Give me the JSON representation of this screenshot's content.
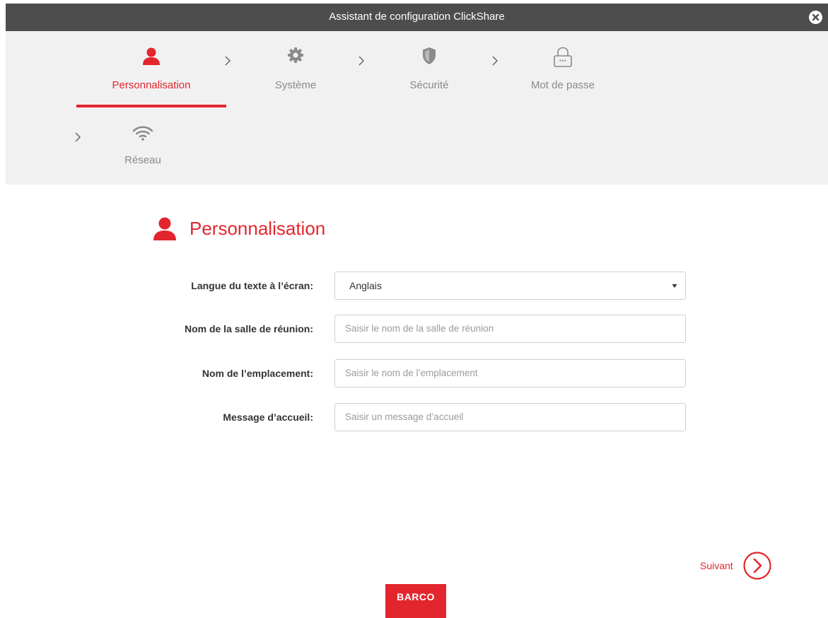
{
  "window": {
    "title": "Assistant de configuration ClickShare"
  },
  "steps": [
    {
      "label": "Personnalisation",
      "icon": "user-icon",
      "active": true
    },
    {
      "label": "Système",
      "icon": "gear-icon",
      "active": false
    },
    {
      "label": "Sécurité",
      "icon": "shield-icon",
      "active": false
    },
    {
      "label": "Mot de passe",
      "icon": "lock-icon",
      "active": false
    },
    {
      "label": "Réseau",
      "icon": "wifi-icon",
      "active": false
    }
  ],
  "section": {
    "title": "Personnalisation",
    "icon": "user-icon"
  },
  "form": {
    "language": {
      "label": "Langue du texte à l’écran:",
      "value": "Anglais"
    },
    "room_name": {
      "label": "Nom de la salle de réunion:",
      "placeholder": "Saisir le nom de la salle de réunion",
      "value": ""
    },
    "location": {
      "label": "Nom de l’emplacement:",
      "placeholder": "Saisir le nom de l’emplacement",
      "value": ""
    },
    "welcome": {
      "label": "Message d’accueil:",
      "placeholder": "Saisir un message d’accueil",
      "value": ""
    }
  },
  "footer": {
    "next_label": "Suivant",
    "logo_text": "BARCO"
  },
  "colors": {
    "accent": "#e3262d",
    "titlebar": "#4d4d4d",
    "steps_bg": "#f1f1f1",
    "muted": "#8a8a8a"
  }
}
